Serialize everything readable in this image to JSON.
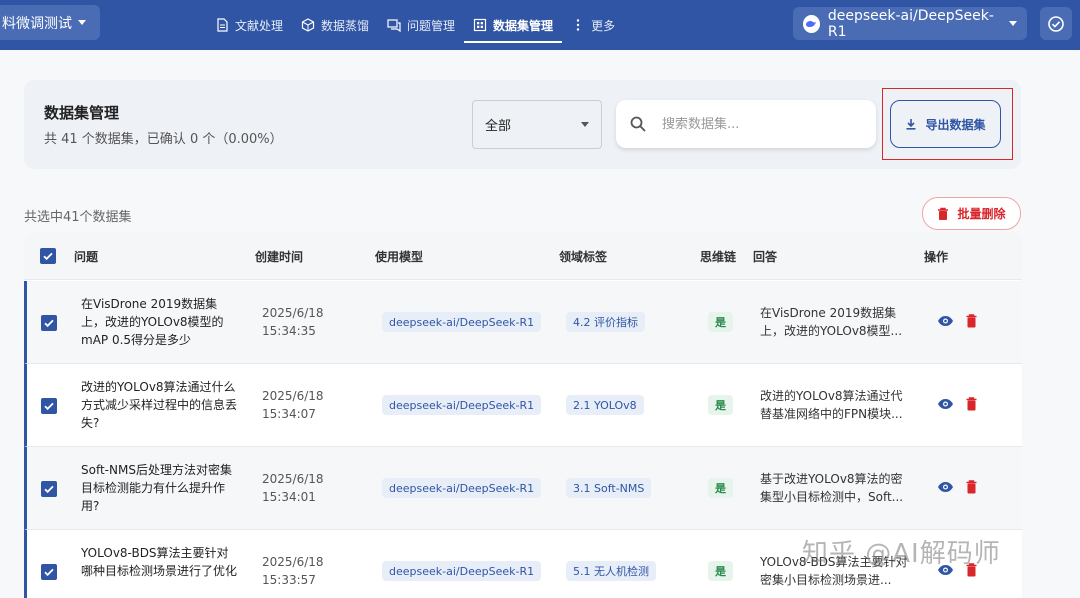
{
  "topbar": {
    "project_label": "料微调测试",
    "nav": [
      {
        "label": "文献处理",
        "icon": "document-icon"
      },
      {
        "label": "数据蒸馏",
        "icon": "cube-icon"
      },
      {
        "label": "问题管理",
        "icon": "chat-icon"
      },
      {
        "label": "数据集管理",
        "icon": "grid-icon",
        "active": true
      },
      {
        "label": "更多",
        "icon": "more-vertical-icon"
      }
    ],
    "model_label": "deepseek-ai/DeepSeek-R1"
  },
  "header": {
    "title": "数据集管理",
    "subtitle": "共 41 个数据集，已确认 0 个（0.00%）",
    "filter_value": "全部",
    "search_placeholder": "搜索数据集...",
    "export_label": "导出数据集"
  },
  "selection": {
    "info": "共选中41个数据集",
    "batch_delete_label": "批量删除"
  },
  "table": {
    "headers": [
      "问题",
      "创建时间",
      "使用模型",
      "领域标签",
      "思维链",
      "回答",
      "操作"
    ],
    "rows": [
      {
        "question": "在VisDrone 2019数据集上，改进的YOLOv8模型的mAP 0.5得分是多少",
        "date": "2025/6/18",
        "time": "15:34:35",
        "model": "deepseek-ai/DeepSeek-R1",
        "tag": "4.2 评价指标",
        "cot": "是",
        "answer": "在VisDrone 2019数据集上，改进的YOLOv8模型..."
      },
      {
        "question": "改进的YOLOv8算法通过什么方式减少采样过程中的信息丢失?",
        "date": "2025/6/18",
        "time": "15:34:07",
        "model": "deepseek-ai/DeepSeek-R1",
        "tag": "2.1 YOLOv8",
        "cot": "是",
        "answer": "改进的YOLOv8算法通过代替基准网络中的FPN模块..."
      },
      {
        "question": "Soft-NMS后处理方法对密集目标检测能力有什么提升作用?",
        "date": "2025/6/18",
        "time": "15:34:01",
        "model": "deepseek-ai/DeepSeek-R1",
        "tag": "3.1 Soft-NMS",
        "cot": "是",
        "answer": "基于改进YOLOv8算法的密集型小目标检测中，Soft..."
      },
      {
        "question": "YOLOv8-BDS算法主要针对哪种目标检测场景进行了优化",
        "date": "2025/6/18",
        "time": "15:33:57",
        "model": "deepseek-ai/DeepSeek-R1",
        "tag": "5.1 无人机检测",
        "cot": "是",
        "answer": "YOLOv8-BDS算法主要针对密集小目标检测场景进..."
      }
    ]
  },
  "watermark": "知乎 @AI解码师",
  "colors": {
    "primary": "#2f55a4",
    "danger": "#d9262b",
    "success": "#2d8a4e"
  }
}
